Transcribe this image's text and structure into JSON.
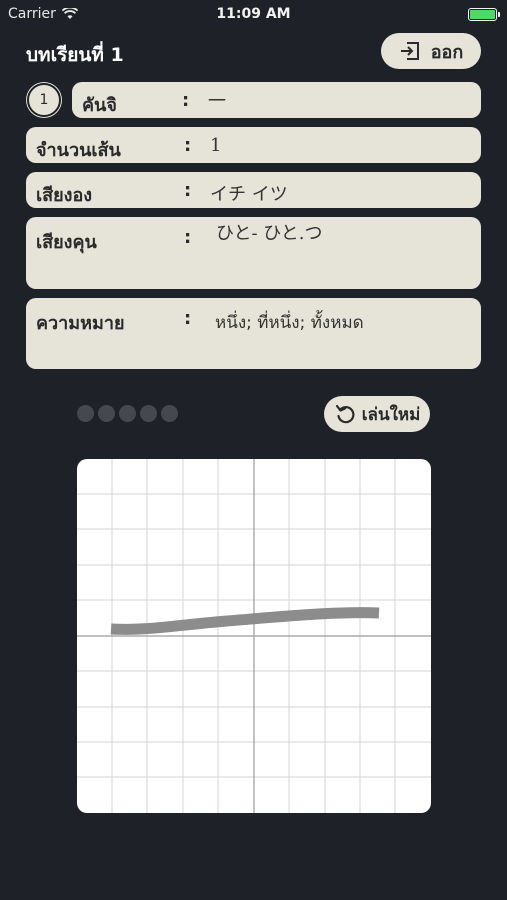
{
  "status_bar": {
    "carrier": "Carrier",
    "time": "11:09 AM",
    "battery_level": 1.0,
    "battery_color": "#4cd964"
  },
  "header": {
    "lesson_title": "บทเรียนที่ 1",
    "exit_label": "ออก",
    "exit_icon": "exit-door-icon"
  },
  "kanji_info": {
    "number": "1",
    "rows": [
      {
        "label": "คันจิ",
        "value": "一"
      },
      {
        "label": "จำนวนเส้น",
        "value": "1"
      },
      {
        "label": "เสียงอง",
        "value": "イチ イツ"
      },
      {
        "label": "เสียงคุน",
        "value": "ひと- ひと.つ"
      },
      {
        "label": "ความหมาย",
        "value": "หนึ่ง; ที่หนึ่ง; ทั้งหมด"
      }
    ],
    "separator": ":"
  },
  "practice": {
    "progress_dots_total": 5,
    "progress_dots_filled": 0,
    "replay_label": "เล่นใหม่",
    "replay_icon": "replay-icon"
  },
  "colors": {
    "background": "#1e2228",
    "card": "#e6e4d8",
    "stroke": "#8c8c8c",
    "grid": "#cfcfcf"
  }
}
